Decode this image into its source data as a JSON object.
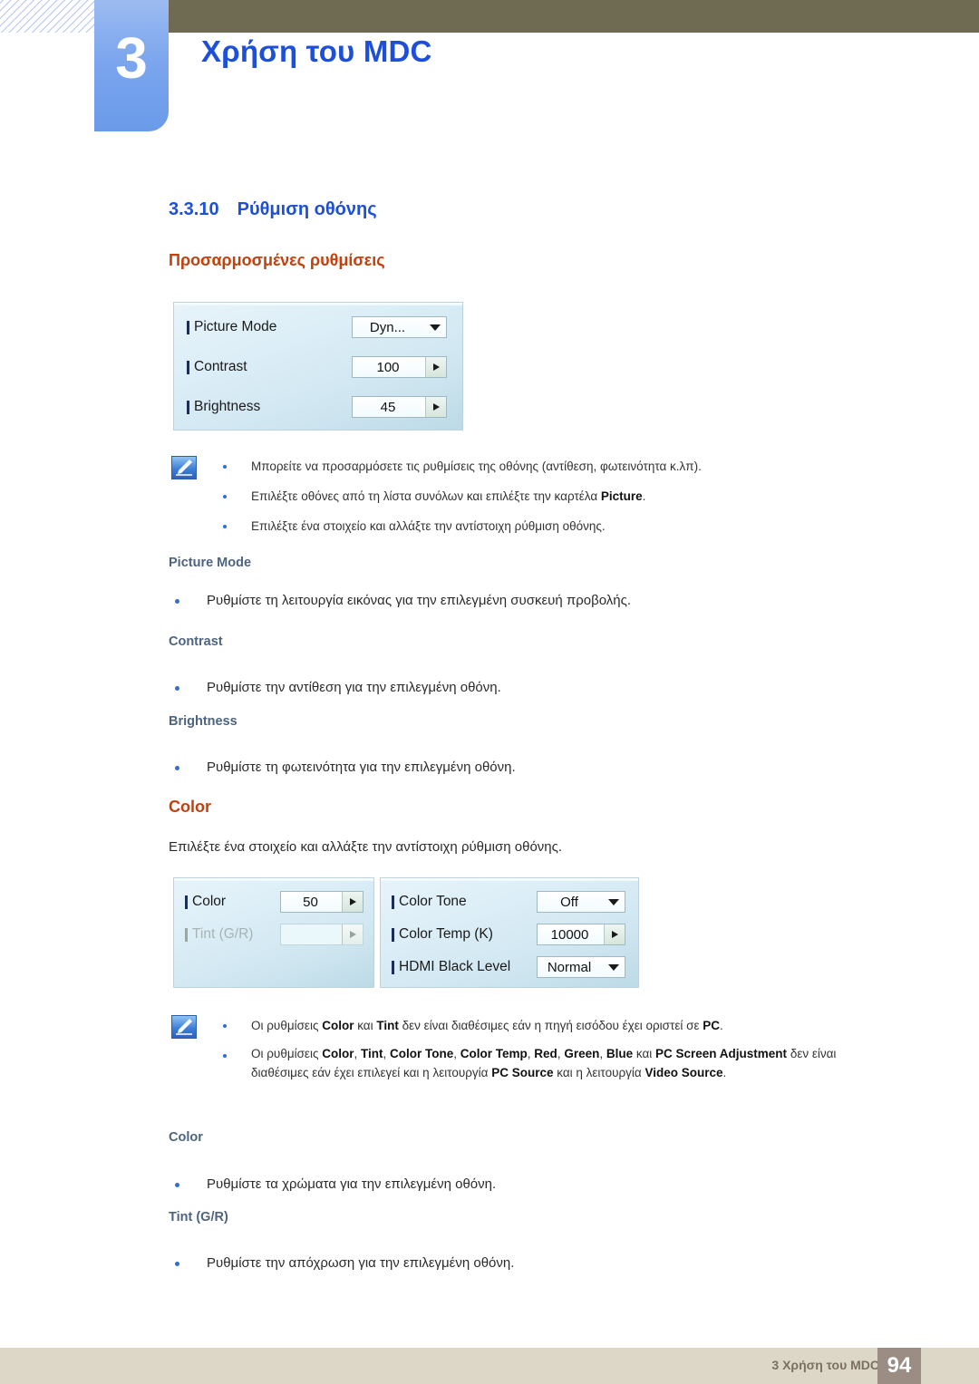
{
  "header": {
    "chapter_number": "3",
    "chapter_title": "Χρήση του MDC"
  },
  "section": {
    "number": "3.3.10",
    "title": "Ρύθμιση οθόνης",
    "subtitle": "Προσαρμοσμένες ρυθμίσεις"
  },
  "picture_panel": {
    "rows": [
      {
        "label": "Picture Mode",
        "value": "Dyn...",
        "type": "combo"
      },
      {
        "label": "Contrast",
        "value": "100",
        "type": "spinner"
      },
      {
        "label": "Brightness",
        "value": "45",
        "type": "spinner"
      }
    ]
  },
  "note1": {
    "icon": "note-pencil-icon",
    "bullets": [
      "Μπορείτε να προσαρμόσετε τις ρυθμίσεις της οθόνης (αντίθεση, φωτεινότητα κ.λπ).",
      "Επιλέξτε οθόνες από τη λίστα συνόλων και επιλέξτε την καρτέλα Picture.",
      "Επιλέξτε ένα στοιχείο και αλλάξτε την αντίστοιχη ρύθμιση οθόνης."
    ],
    "bullet2_prefix": "Επιλέξτε οθόνες από τη λίστα συνόλων και επιλέξτε την καρτέλα ",
    "bullet2_bold": "Picture",
    "bullet2_suffix": "."
  },
  "topics": [
    {
      "heading": "Picture Mode",
      "text": "Ρυθμίστε τη λειτουργία εικόνας για την επιλεγμένη συσκευή προβολής."
    },
    {
      "heading": "Contrast",
      "text": "Ρυθμίστε την αντίθεση για την επιλεγμένη οθόνη."
    },
    {
      "heading": "Brightness",
      "text": "Ρυθμίστε τη φωτεινότητα για την επιλεγμένη οθόνη."
    }
  ],
  "color_section": {
    "heading": "Color",
    "intro": "Επιλέξτε ένα στοιχείο και αλλάξτε την αντίστοιχη ρύθμιση οθόνης."
  },
  "color_panel_left": {
    "rows": [
      {
        "label": "Color",
        "value": "50",
        "type": "spinner",
        "disabled": false
      },
      {
        "label": "Tint (G/R)",
        "value": "",
        "type": "spinner",
        "disabled": true
      }
    ]
  },
  "color_panel_right": {
    "rows": [
      {
        "label": "Color Tone",
        "value": "Off",
        "type": "combo"
      },
      {
        "label": "Color Temp (K)",
        "value": "10000",
        "type": "spinner"
      },
      {
        "label": "HDMI Black Level",
        "value": "Normal",
        "type": "combo"
      }
    ]
  },
  "note2": {
    "icon": "note-pencil-icon",
    "b1": {
      "p1": "Οι ρυθμίσεις ",
      "b1": "Color",
      "p2": " και ",
      "b2": "Tint",
      "p3": " δεν είναι διαθέσιμες εάν η πηγή εισόδου έχει οριστεί σε ",
      "b3": "PC",
      "p4": "."
    },
    "b2": {
      "p1": "Οι ρυθμίσεις ",
      "b1": "Color",
      "p2": ", ",
      "b2": "Tint",
      "p3": ", ",
      "b3": "Color Tone",
      "p4": ", ",
      "b4": "Color Temp",
      "p5": ", ",
      "b5": "Red",
      "p6": ", ",
      "b6": "Green",
      "p7": ", ",
      "b7": "Blue",
      "p8": " και ",
      "b8": "PC Screen Adjustment",
      "p9": " δεν είναι διαθέσιμες εάν έχει επιλεγεί και η λειτουργία ",
      "b9": "PC Source",
      "p10": " και η λειτουργία ",
      "b10": "Video Source",
      "p11": "."
    }
  },
  "topics2": [
    {
      "heading": "Color",
      "text": "Ρυθμίστε τα χρώματα για την επιλεγμένη οθόνη."
    },
    {
      "heading": "Tint (G/R)",
      "text": "Ρυθμίστε την απόχρωση για την επιλεγμένη οθόνη."
    }
  ],
  "footer": {
    "label": "3 Χρήση του MDC",
    "page": "94"
  }
}
